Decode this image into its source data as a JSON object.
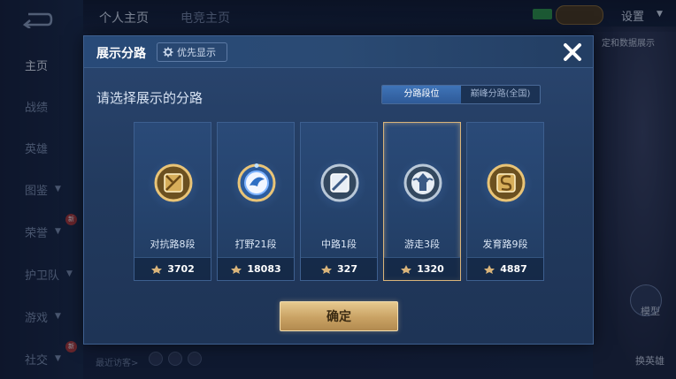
{
  "sidebar": {
    "items": [
      {
        "label": "主页",
        "active": true,
        "chevron": false
      },
      {
        "label": "战绩",
        "active": false,
        "chevron": false
      },
      {
        "label": "英雄",
        "active": false,
        "chevron": false
      },
      {
        "label": "图鉴",
        "active": false,
        "chevron": true
      },
      {
        "label": "荣誉",
        "active": false,
        "chevron": true,
        "badge": "新"
      },
      {
        "label": "护卫队",
        "active": false,
        "chevron": true
      },
      {
        "label": "游戏",
        "active": false,
        "chevron": true
      },
      {
        "label": "社交",
        "active": false,
        "chevron": true,
        "badge": "新"
      }
    ]
  },
  "topbar": {
    "tabs": [
      "个人主页",
      "电竞主页"
    ],
    "settings_label": "设置"
  },
  "background": {
    "right_text": "定和数据展示",
    "hero_buttons": [
      "模型",
      "换英雄"
    ],
    "visitors_label": "最近访客>"
  },
  "dialog": {
    "title": "展示分路",
    "priority_label": "优先显示",
    "subtitle": "请选择展示的分路",
    "toggle": {
      "options": [
        "分路段位",
        "巅峰分路(全国)"
      ],
      "active_index": 0
    },
    "cards": [
      {
        "rank": "对抗路8段",
        "score": "3702",
        "emblem": "clash-lane-emblem-icon",
        "selected": false
      },
      {
        "rank": "打野21段",
        "score": "18083",
        "emblem": "jungle-emblem-icon",
        "selected": false
      },
      {
        "rank": "中路1段",
        "score": "327",
        "emblem": "mid-lane-emblem-icon",
        "selected": false
      },
      {
        "rank": "游走3段",
        "score": "1320",
        "emblem": "roam-emblem-icon",
        "selected": true
      },
      {
        "rank": "发育路9段",
        "score": "4887",
        "emblem": "farm-lane-emblem-icon",
        "selected": false
      }
    ],
    "confirm_label": "确定"
  },
  "colors": {
    "accent_gold": "#d9b47a",
    "dialog_bg": "#223a5e",
    "toggle_active": "#3f74b8"
  }
}
